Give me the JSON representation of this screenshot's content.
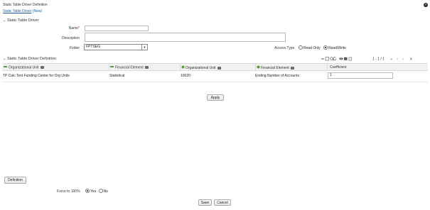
{
  "page": {
    "title": "Static Table Driver Definition",
    "breadcrumb_link": "Static Table Driver",
    "breadcrumb_suffix": "(New)",
    "help_icon": "?"
  },
  "static_table_driver": {
    "section_title": "Static Table Driver",
    "name_label": "Name",
    "name_required": "*",
    "name_value": "",
    "description_label": "Description",
    "description_value": "",
    "folder_label": "Folder",
    "folder_value": "FPTSEG",
    "access_type_label": "Access Type",
    "access_options": [
      "Read Only",
      "Read/Write"
    ],
    "access_selected": "Read/Write"
  },
  "definition": {
    "section_title": "Static Table Driver Definition",
    "pagination": "1 - 1 / 1",
    "columns": [
      "Organizational Unit",
      "Financial Element",
      "Organizational Unit",
      "Financial Element",
      "Coefficient"
    ],
    "rows": [
      {
        "org_unit_1": "TP Calc Test Funding Center for Org Units",
        "fin_elem_1": "Statistical",
        "org_unit_2": "10020",
        "fin_elem_2": "Ending Number of Accounts",
        "coefficient": "1"
      }
    ],
    "apply_label": "Apply"
  },
  "footer": {
    "definition_label": "Definition",
    "force_label": "Force to 100%",
    "force_options": [
      "Yes",
      "No"
    ],
    "force_selected": "Yes",
    "save_label": "Save",
    "cancel_label": "Cancel"
  },
  "icons": [
    "help-icon",
    "chevron-down-icon",
    "add-icon",
    "search-icon",
    "refresh-icon",
    "view-icon",
    "grid-icon",
    "lookup-icon",
    "delete-icon",
    "first-page-icon",
    "prev-page-icon",
    "next-page-icon",
    "last-page-icon"
  ]
}
